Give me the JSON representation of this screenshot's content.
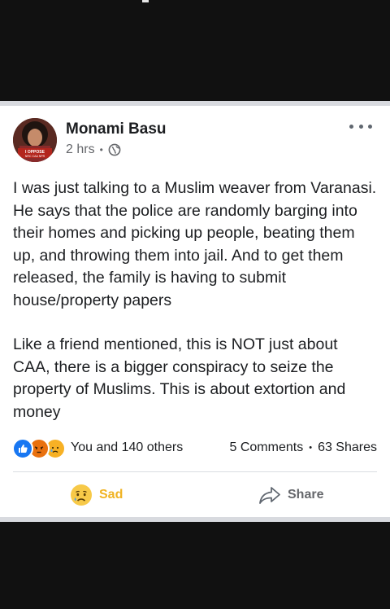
{
  "post": {
    "author": "Monami Basu",
    "time": "2 hrs",
    "meta_separator": "•",
    "avatar_badge_line1": "I OPPOSE",
    "avatar_badge_line2": "NRC CAA NPR",
    "paragraphs": [
      "I was just talking to a Muslim weaver from Varanasi. He says that the police are randomly barging into their homes and picking up people, beating them up, and throwing them into jail. And to get them released, the family is having to submit house/property papers",
      "Like a friend mentioned, this is NOT just about CAA, there is a bigger conspiracy to seize the property of Muslims. This is about extortion and money"
    ]
  },
  "engagement": {
    "reaction_icons": [
      "like-icon",
      "angry-icon",
      "sad-icon"
    ],
    "reactions_text": "You and 140 others",
    "comments": "5 Comments",
    "separator": "•",
    "shares": "63 Shares"
  },
  "actions": {
    "reaction_label": "Sad",
    "share_label": "Share"
  },
  "colors": {
    "like": "#1877f2",
    "angry": "#e9710f",
    "sad": "#f7b125",
    "sad_label": "#f0b323"
  }
}
